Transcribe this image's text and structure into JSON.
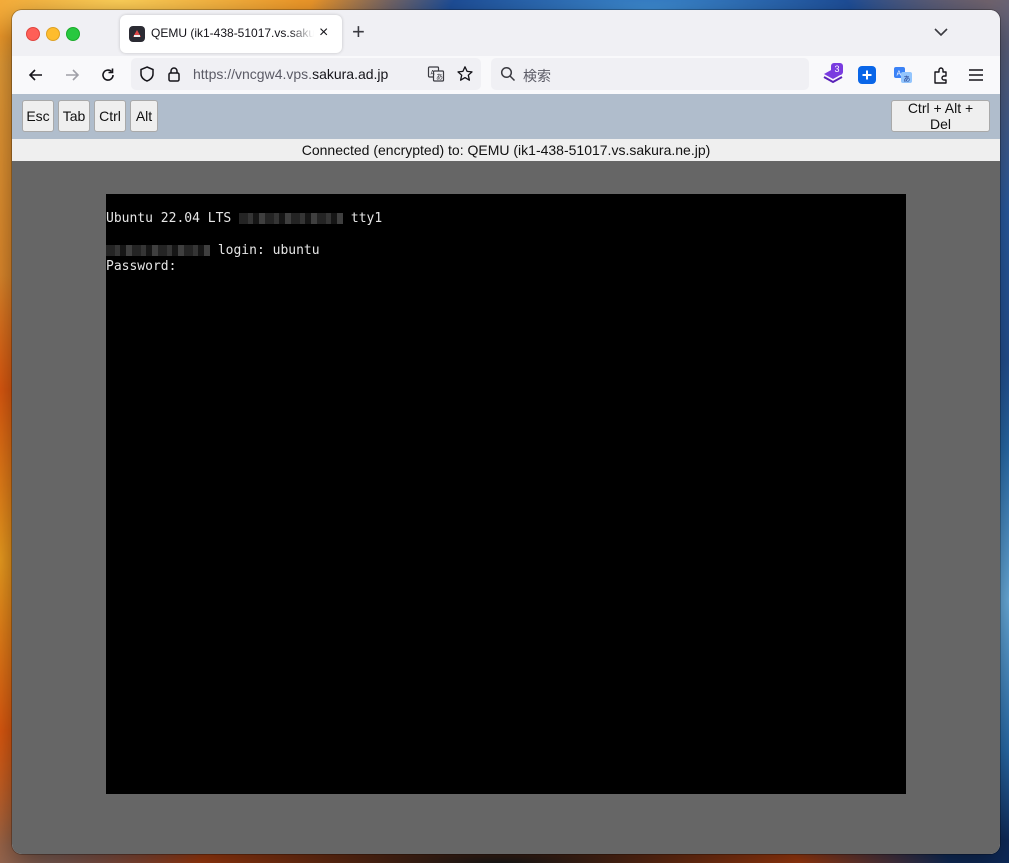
{
  "browser": {
    "tab": {
      "title": "QEMU (ik1-438-51017.vs.sakura.ne.jp)",
      "close_glyph": "×",
      "favicon": "novnc-favicon-icon"
    },
    "new_tab_glyph": "+",
    "url": {
      "prefix": "https://vncgw4.vps.",
      "domain": "sakura.ad.jp"
    },
    "search_placeholder": "検索",
    "extension_badge_count": "3",
    "colors": {
      "chrome_bg": "#f0f0f4",
      "nav_bg": "#f9f9fb",
      "accent_blue": "#0060df",
      "extension_purple": "#7a3ce0"
    }
  },
  "vnc": {
    "keys": {
      "esc": "Esc",
      "tab": "Tab",
      "ctrl": "Ctrl",
      "alt": "Alt",
      "cad": "Ctrl + Alt + Del"
    },
    "status": "Connected (encrypted) to: QEMU (ik1-438-51017.vs.sakura.ne.jp)",
    "colors": {
      "control_bar_bg": "#b0bdcc",
      "canvas_bg": "#666666",
      "screen_bg": "#000000"
    }
  },
  "console": {
    "line1_prefix": "Ubuntu 22.04 LTS",
    "line1_suffix": "tty1",
    "line2_suffix": "login: ubuntu",
    "line3": "Password:"
  }
}
